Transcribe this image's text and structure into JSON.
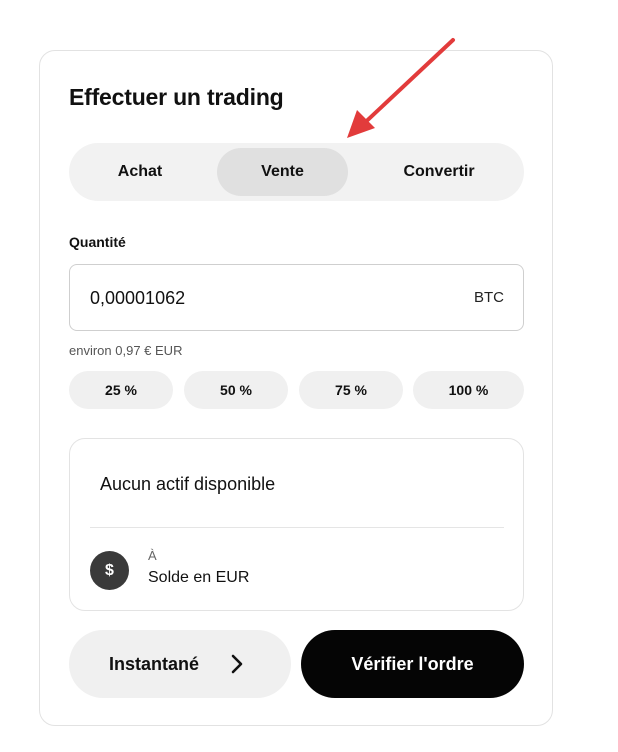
{
  "header": {
    "title": "Effectuer un trading"
  },
  "tabs": [
    {
      "label": "Achat",
      "active": false
    },
    {
      "label": "Vente",
      "active": true
    },
    {
      "label": "Convertir",
      "active": false
    }
  ],
  "quantity": {
    "label": "Quantité",
    "value": "0,00001062",
    "unit": "BTC",
    "approx": "environ 0,97 € EUR"
  },
  "percent_buttons": [
    "25 %",
    "50 %",
    "75 %",
    "100 %"
  ],
  "assets": {
    "empty_text": "Aucun actif disponible",
    "to_label": "À",
    "balance_label": "Solde en EUR",
    "icon_glyph": "$"
  },
  "actions": {
    "instant_label": "Instantané",
    "verify_label": "Vérifier l'ordre"
  },
  "colors": {
    "annotation_arrow": "#e23b3b",
    "primary_button": "#050505",
    "tab_active": "#e0e0e0",
    "tab_track": "#f2f2f2"
  },
  "icons": {
    "chevron": "chevron-right-icon",
    "currency": "dollar-icon",
    "annotation": "red-arrow-annotation"
  }
}
